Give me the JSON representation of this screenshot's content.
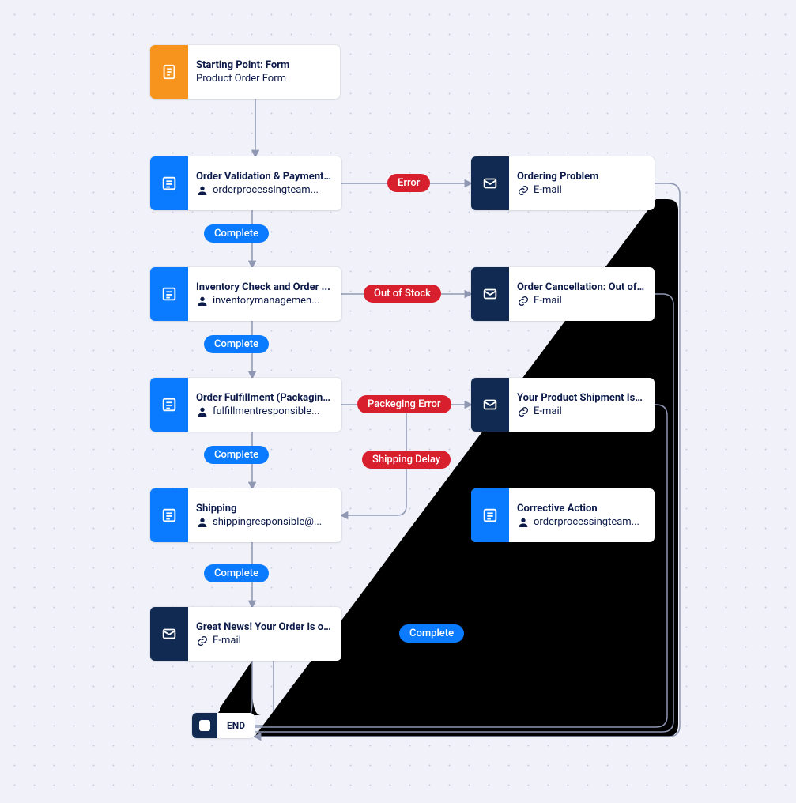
{
  "nodes": {
    "start": {
      "title": "Starting Point: Form",
      "sub": "Product Order Form"
    },
    "validate": {
      "title": "Order Validation & Payment ...",
      "sub": "orderprocessingteam..."
    },
    "inventory": {
      "title": "Inventory Check and Order ...",
      "sub": "inventorymanagemen..."
    },
    "fulfill": {
      "title": "Order Fulfillment (Packaging...",
      "sub": "fulfillmentresponsible..."
    },
    "shipping": {
      "title": "Shipping",
      "sub": "shippingresponsible@..."
    },
    "great": {
      "title": "Great News! Your Order is on...",
      "sub": "E-mail"
    },
    "problem": {
      "title": "Ordering Problem",
      "sub": "E-mail"
    },
    "cancel": {
      "title": "Order Cancellation: Out of St...",
      "sub": "E-mail"
    },
    "delay": {
      "title": "Your Product Shipment Is Del...",
      "sub": "E-mail"
    },
    "corrective": {
      "title": "Corrective Action",
      "sub": "orderprocessingteam..."
    },
    "end": {
      "label": "END"
    }
  },
  "pills": {
    "complete1": "Complete",
    "complete2": "Complete",
    "complete3": "Complete",
    "complete4": "Complete",
    "complete5": "Complete",
    "error": "Error",
    "oos": "Out of Stock",
    "pkgerr": "Packeging Error",
    "shipdelay": "Shipping Delay"
  }
}
